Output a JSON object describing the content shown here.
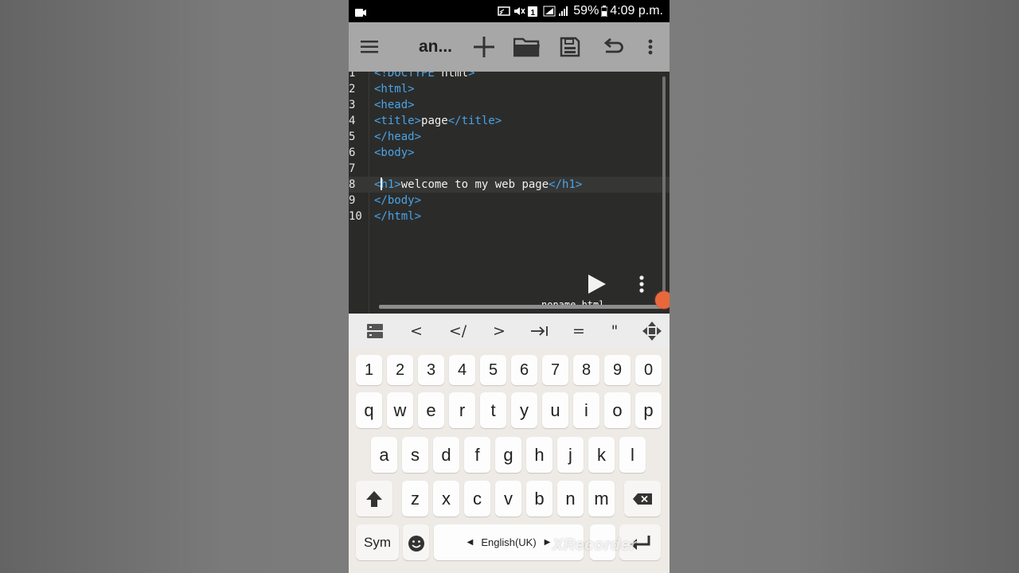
{
  "status_bar": {
    "battery": "59%",
    "time": "4:09 p.m."
  },
  "toolbar": {
    "title": "an...",
    "icons": [
      "menu-icon",
      "plus-icon",
      "folder-icon",
      "save-icon",
      "undo-icon",
      "more-vert-icon"
    ]
  },
  "editor": {
    "lines": [
      {
        "num": "1",
        "parts": [
          {
            "t": "tag",
            "v": "<!DOCTYPE"
          },
          {
            "t": "txt",
            "v": " html"
          },
          {
            "t": "tag",
            "v": ">"
          }
        ]
      },
      {
        "num": "2",
        "parts": [
          {
            "t": "tag",
            "v": "<html>"
          }
        ]
      },
      {
        "num": "3",
        "parts": [
          {
            "t": "tag",
            "v": "<head>"
          }
        ]
      },
      {
        "num": "4",
        "parts": [
          {
            "t": "tag",
            "v": "<title>"
          },
          {
            "t": "txt",
            "v": "page"
          },
          {
            "t": "tag",
            "v": "</title>"
          }
        ]
      },
      {
        "num": "5",
        "parts": [
          {
            "t": "tag",
            "v": "</head>"
          }
        ]
      },
      {
        "num": "6",
        "parts": [
          {
            "t": "tag",
            "v": "<body>"
          }
        ]
      },
      {
        "num": "7",
        "parts": []
      },
      {
        "num": "8",
        "current": true,
        "parts": [
          {
            "t": "tag",
            "v": "<"
          },
          {
            "t": "cursor",
            "v": ""
          },
          {
            "t": "tag",
            "v": "h1>"
          },
          {
            "t": "txt",
            "v": "welcome to my web page"
          },
          {
            "t": "tag",
            "v": "</h1>"
          }
        ]
      },
      {
        "num": "9",
        "parts": [
          {
            "t": "tag",
            "v": "</body>"
          }
        ]
      },
      {
        "num": "10",
        "parts": [
          {
            "t": "tag",
            "v": "</html>"
          }
        ]
      }
    ],
    "filename": "noname.html"
  },
  "symbol_bar": {
    "symbols": [
      "<",
      "</",
      ">",
      "→|",
      "=",
      "\""
    ]
  },
  "keyboard": {
    "numbers": [
      "1",
      "2",
      "3",
      "4",
      "5",
      "6",
      "7",
      "8",
      "9",
      "0"
    ],
    "row1": [
      "q",
      "w",
      "e",
      "r",
      "t",
      "y",
      "u",
      "i",
      "o",
      "p"
    ],
    "row2": [
      "a",
      "s",
      "d",
      "f",
      "g",
      "h",
      "j",
      "k",
      "l"
    ],
    "row3": [
      "z",
      "x",
      "c",
      "v",
      "b",
      "n",
      "m"
    ],
    "sym_label": "Sym",
    "language": "English(UK)",
    "watermark": "XRecorder"
  },
  "colors": {
    "toolbar_bg": "#a7a7a7",
    "editor_bg": "#2b2c2a",
    "tag_color": "#4aa3e8",
    "text_color": "#f0f0f0"
  }
}
